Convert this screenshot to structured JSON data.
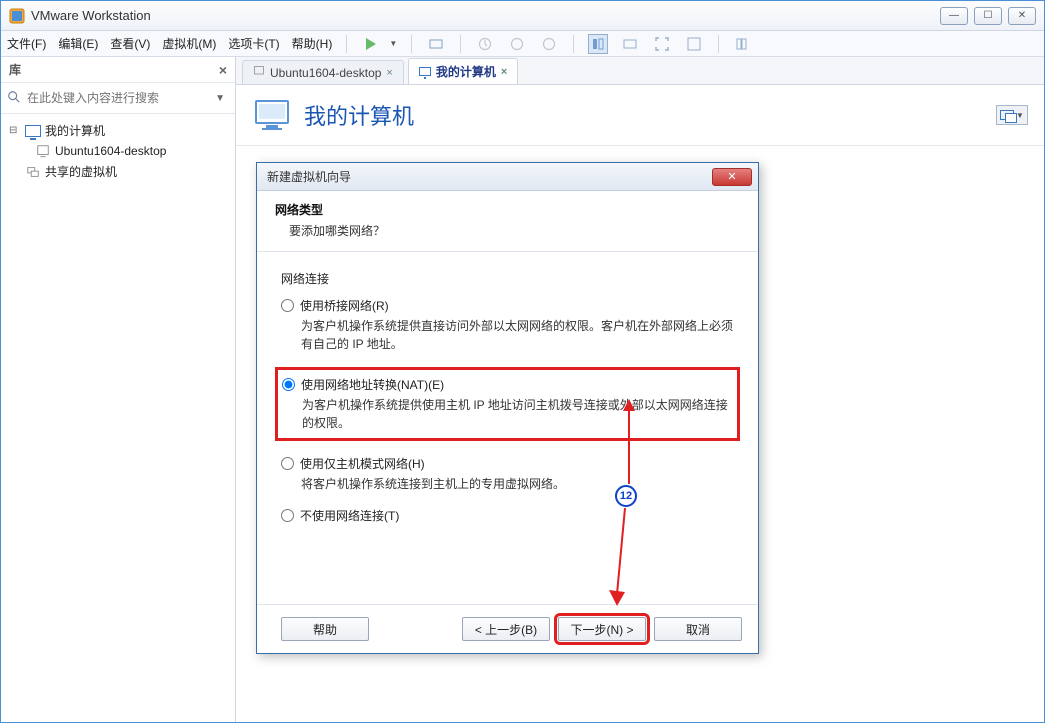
{
  "titlebar": {
    "app_name": "VMware Workstation"
  },
  "menubar": {
    "file": "文件(F)",
    "edit": "编辑(E)",
    "view": "查看(V)",
    "vm": "虚拟机(M)",
    "tabs": "选项卡(T)",
    "help": "帮助(H)"
  },
  "sidebar": {
    "title": "库",
    "search_placeholder": "在此处键入内容进行搜索",
    "tree": {
      "root": "我的计算机",
      "vm": "Ubuntu1604-desktop",
      "shared": "共享的虚拟机"
    }
  },
  "tabs": [
    {
      "label": "Ubuntu1604-desktop",
      "active": false
    },
    {
      "label": "我的计算机",
      "active": true
    }
  ],
  "page": {
    "title": "我的计算机"
  },
  "dialog": {
    "title": "新建虚拟机向导",
    "heading": "网络类型",
    "subheading": "要添加哪类网络？",
    "section": "网络连接",
    "options": [
      {
        "label": "使用桥接网络(R)",
        "desc": "为客户机操作系统提供直接访问外部以太网网络的权限。客户机在外部网络上必须有自己的 IP 地址。",
        "checked": false
      },
      {
        "label": "使用网络地址转换(NAT)(E)",
        "desc": "为客户机操作系统提供使用主机 IP 地址访问主机拨号连接或外部以太网网络连接的权限。",
        "checked": true,
        "highlight": true
      },
      {
        "label": "使用仅主机模式网络(H)",
        "desc": "将客户机操作系统连接到主机上的专用虚拟网络。",
        "checked": false
      },
      {
        "label": "不使用网络连接(T)",
        "desc": "",
        "checked": false
      }
    ],
    "buttons": {
      "help": "帮助",
      "back": "< 上一步(B)",
      "next": "下一步(N) >",
      "cancel": "取消"
    }
  },
  "annotation": {
    "num": "12"
  }
}
